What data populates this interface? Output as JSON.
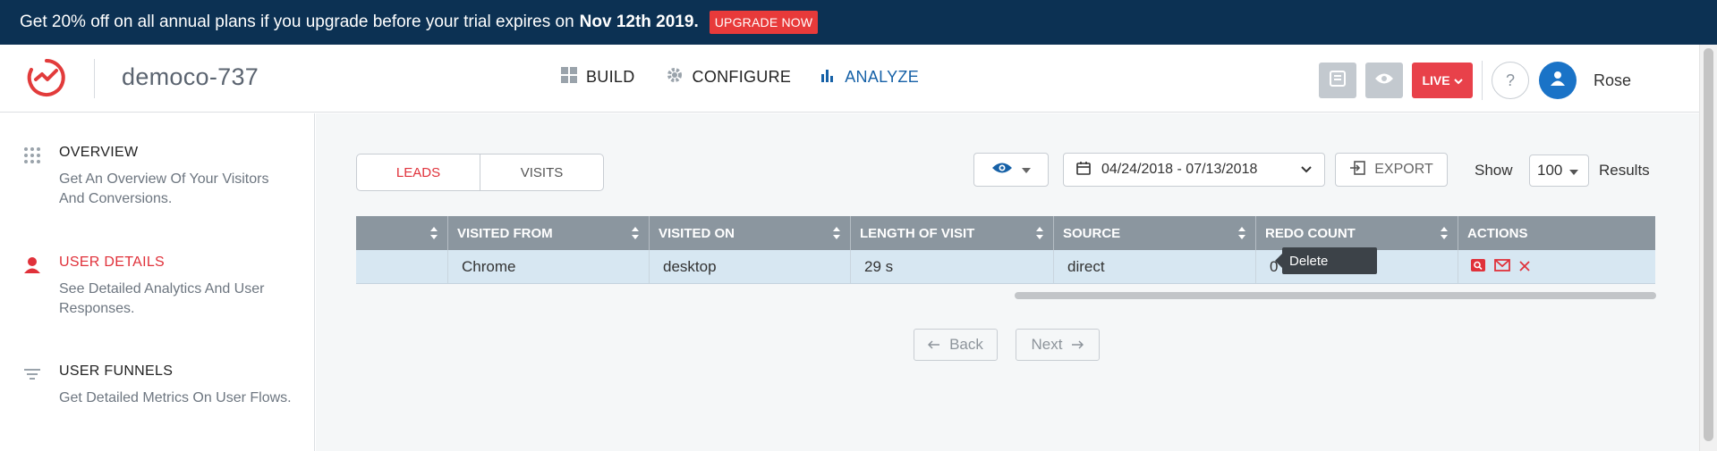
{
  "promo": {
    "text": "Get 20% off on all annual plans if you upgrade before your trial expires on",
    "date": "Nov 12th 2019.",
    "upgrade_label": "UPGRADE NOW"
  },
  "header": {
    "project_name": "democo-737",
    "nav": [
      {
        "label": "BUILD",
        "icon": "grid-icon"
      },
      {
        "label": "CONFIGURE",
        "icon": "gear-icon"
      },
      {
        "label": "ANALYZE",
        "icon": "bar-chart-icon",
        "active": true
      }
    ],
    "live_label": "LIVE",
    "help_label": "?",
    "user_name": "Rose"
  },
  "sidebar": {
    "items": [
      {
        "title": "OVERVIEW",
        "desc": "Get An Overview Of Your Visitors And Conversions.",
        "icon": "dots-grid-icon"
      },
      {
        "title": "USER DETAILS",
        "desc": "See Detailed Analytics And User Responses.",
        "icon": "user-icon",
        "active": true
      },
      {
        "title": "USER FUNNELS",
        "desc": "Get Detailed Metrics On User Flows.",
        "icon": "funnel-icon"
      }
    ]
  },
  "main": {
    "tabs": [
      {
        "label": "LEADS",
        "active": true
      },
      {
        "label": "VISITS"
      }
    ],
    "date_range": "04/24/2018 - 07/13/2018",
    "export_label": "EXPORT",
    "show_label": "Show",
    "show_value": "100",
    "results_label": "Results",
    "table": {
      "columns": [
        "",
        "VISITED FROM",
        "VISITED ON",
        "LENGTH OF VISIT",
        "SOURCE",
        "REDO COUNT",
        "ACTIONS"
      ],
      "rows": [
        [
          "",
          "Chrome",
          "desktop",
          "29 s",
          "direct",
          "0",
          ""
        ]
      ]
    },
    "tooltip": "Delete",
    "back_label": "Back",
    "next_label": "Next"
  },
  "colors": {
    "banner": "#0c3153",
    "accent_red": "#e0313a",
    "analyze_blue": "#1661a7",
    "table_header": "#8b969f",
    "row_bg": "#d7e7f2"
  }
}
